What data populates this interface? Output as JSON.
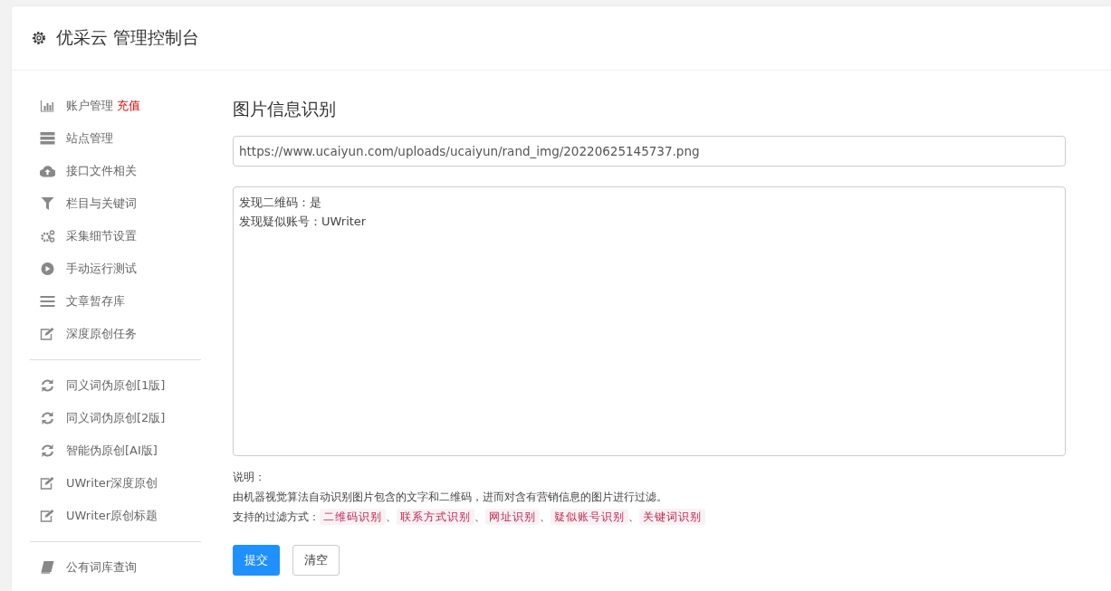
{
  "header": {
    "title": "优采云 管理控制台"
  },
  "sidebar": {
    "groups": [
      {
        "items": [
          {
            "label": "账户管理",
            "badge": "充值",
            "kind": "chart"
          },
          {
            "label": "站点管理",
            "kind": "server"
          },
          {
            "label": "接口文件相关",
            "kind": "cloud"
          },
          {
            "label": "栏目与关键词",
            "kind": "filter"
          },
          {
            "label": "采集细节设置",
            "kind": "gears"
          },
          {
            "label": "手动运行测试",
            "kind": "play"
          },
          {
            "label": "文章暂存库",
            "kind": "list"
          },
          {
            "label": "深度原创任务",
            "kind": "edit"
          }
        ]
      },
      {
        "items": [
          {
            "label": "同义词伪原创[1版]",
            "kind": "refresh"
          },
          {
            "label": "同义词伪原创[2版]",
            "kind": "refresh"
          },
          {
            "label": "智能伪原创[AI版]",
            "kind": "refresh"
          },
          {
            "label": "UWriter深度原创",
            "kind": "edit"
          },
          {
            "label": "UWriter原创标题",
            "kind": "edit"
          }
        ]
      },
      {
        "items": [
          {
            "label": "公有词库查询",
            "kind": "book"
          }
        ]
      }
    ]
  },
  "main": {
    "title": "图片信息识别",
    "url_field": {
      "value": "https://www.ucaiyun.com/uploads/ucaiyun/rand_img/20220625145737.png"
    },
    "result_box": {
      "lines": [
        "发现二维码：是",
        "发现疑似账号：UWriter"
      ]
    },
    "notes": {
      "heading": "说明：",
      "description": "由机器视觉算法自动识别图片包含的文字和二维码，进而对含有营销信息的图片进行过滤。",
      "methods_label": "支持的过滤方式：",
      "separator": "、",
      "methods": [
        "二维码识别",
        "联系方式识别",
        "网址识别",
        "疑似账号识别",
        "关键词识别"
      ]
    },
    "buttons": [
      {
        "label": "提交",
        "kind": "primary"
      },
      {
        "label": "清空",
        "kind": "default"
      }
    ]
  }
}
